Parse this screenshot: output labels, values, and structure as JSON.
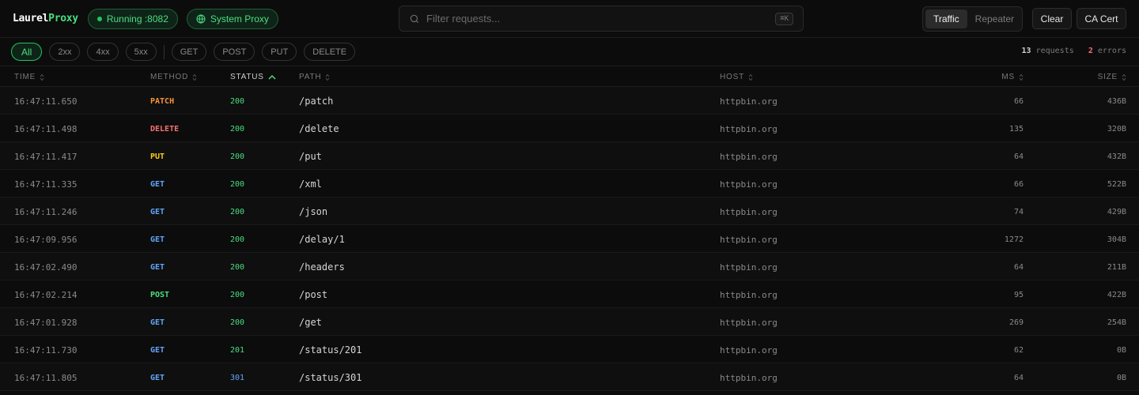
{
  "header": {
    "logo_part1": "Laurel",
    "logo_part2": "Proxy",
    "running_label": "Running :8082",
    "system_proxy_label": "System Proxy",
    "search_placeholder": "Filter requests...",
    "search_shortcut": "⌘K",
    "view_tabs": [
      "Traffic",
      "Repeater"
    ],
    "active_view": "Traffic",
    "clear_label": "Clear",
    "ca_cert_label": "CA Cert"
  },
  "filters": {
    "status_chips": [
      "All",
      "2xx",
      "4xx",
      "5xx"
    ],
    "method_chips": [
      "GET",
      "POST",
      "PUT",
      "DELETE"
    ],
    "active_chip": "All",
    "request_count": "13",
    "request_label": "requests",
    "error_count": "2",
    "error_label": "errors"
  },
  "table": {
    "columns": [
      "TIME",
      "METHOD",
      "STATUS",
      "PATH",
      "HOST",
      "MS",
      "SIZE"
    ],
    "sorted_column": "STATUS",
    "rows": [
      {
        "time": "16:47:11.650",
        "method": "PATCH",
        "status": "200",
        "path": "/patch",
        "host": "httpbin.org",
        "ms": "66",
        "size": "436B"
      },
      {
        "time": "16:47:11.498",
        "method": "DELETE",
        "status": "200",
        "path": "/delete",
        "host": "httpbin.org",
        "ms": "135",
        "size": "320B"
      },
      {
        "time": "16:47:11.417",
        "method": "PUT",
        "status": "200",
        "path": "/put",
        "host": "httpbin.org",
        "ms": "64",
        "size": "432B"
      },
      {
        "time": "16:47:11.335",
        "method": "GET",
        "status": "200",
        "path": "/xml",
        "host": "httpbin.org",
        "ms": "66",
        "size": "522B"
      },
      {
        "time": "16:47:11.246",
        "method": "GET",
        "status": "200",
        "path": "/json",
        "host": "httpbin.org",
        "ms": "74",
        "size": "429B"
      },
      {
        "time": "16:47:09.956",
        "method": "GET",
        "status": "200",
        "path": "/delay/1",
        "host": "httpbin.org",
        "ms": "1272",
        "size": "304B"
      },
      {
        "time": "16:47:02.490",
        "method": "GET",
        "status": "200",
        "path": "/headers",
        "host": "httpbin.org",
        "ms": "64",
        "size": "211B"
      },
      {
        "time": "16:47:02.214",
        "method": "POST",
        "status": "200",
        "path": "/post",
        "host": "httpbin.org",
        "ms": "95",
        "size": "422B"
      },
      {
        "time": "16:47:01.928",
        "method": "GET",
        "status": "200",
        "path": "/get",
        "host": "httpbin.org",
        "ms": "269",
        "size": "254B"
      },
      {
        "time": "16:47:11.730",
        "method": "GET",
        "status": "201",
        "path": "/status/201",
        "host": "httpbin.org",
        "ms": "62",
        "size": "0B"
      },
      {
        "time": "16:47:11.805",
        "method": "GET",
        "status": "301",
        "path": "/status/301",
        "host": "httpbin.org",
        "ms": "64",
        "size": "0B"
      }
    ]
  },
  "colors": {
    "accent": "#4ade80",
    "method_GET": "#60a5fa",
    "method_POST": "#4ade80",
    "method_PUT": "#facc15",
    "method_DELETE": "#f87171",
    "method_PATCH": "#fb923c",
    "status_2xx": "#4ade80",
    "status_3xx": "#60a5fa",
    "error": "#f87171"
  }
}
